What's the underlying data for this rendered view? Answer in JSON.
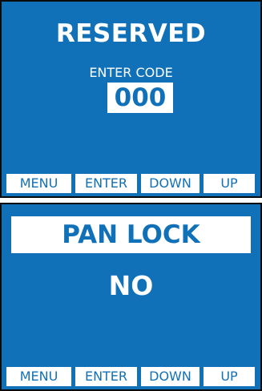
{
  "screen1": {
    "title": "RESERVED",
    "prompt": "ENTER CODE",
    "code": "000",
    "softkeys": [
      "MENU",
      "ENTER",
      "DOWN",
      "UP"
    ]
  },
  "screen2": {
    "title": "PAN LOCK",
    "value": "NO",
    "softkeys": [
      "MENU",
      "ENTER",
      "DOWN",
      "UP"
    ]
  },
  "colors": {
    "screen_bg": "#1171b8",
    "text_light": "#ffffff",
    "frame": "#0a0a0a"
  }
}
